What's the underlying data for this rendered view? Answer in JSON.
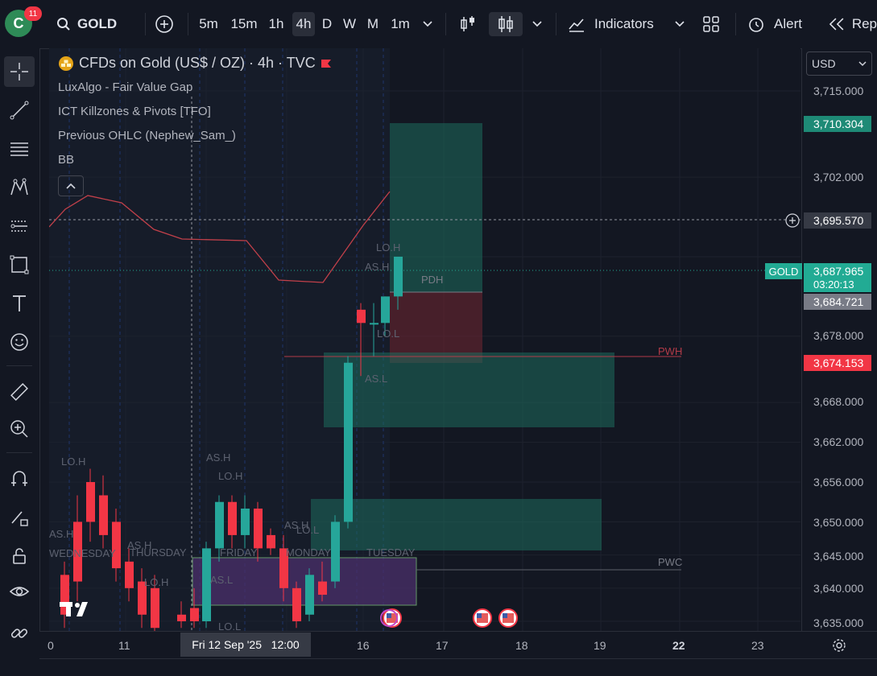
{
  "topbar": {
    "avatar_letter": "C",
    "notif_count": "11",
    "symbol": "GOLD",
    "intervals": [
      "5m",
      "15m",
      "1h",
      "4h",
      "D",
      "W",
      "M",
      "1m"
    ],
    "active_interval": "4h",
    "indicators_label": "Indicators",
    "alert_label": "Alert",
    "replay_label": "Rep"
  },
  "legend": {
    "title": "CFDs on Gold (US$ / OZ) · 4h · TVC",
    "indicators": [
      "LuxAlgo - Fair Value Gap",
      "ICT Killzones & Pivots [TFO]",
      "Previous OHLC (Nephew_Sam_)",
      "BB"
    ]
  },
  "currency": "USD",
  "price_axis": {
    "ticks": [
      "3,715.000",
      "3,702.000",
      "3,678.000",
      "3,668.000",
      "3,662.000",
      "3,656.000",
      "3,650.000",
      "3,645.000",
      "3,640.000",
      "3,635.000"
    ],
    "labels": {
      "target": "3,710.304",
      "crosshair": "3,695.570",
      "symbol_tag": "GOLD",
      "last": "3,687.965",
      "countdown": "03:20:13",
      "prev": "3,684.721",
      "pwh": "3,674.153"
    }
  },
  "time_axis": {
    "ticks": [
      "0",
      "11",
      "16",
      "17",
      "18",
      "19",
      "22",
      "23"
    ],
    "crosshair": "Fri 12 Sep '25   12:00"
  },
  "chart_labels": {
    "lo_h": "LO.H",
    "as_h": "AS.H",
    "lo_l": "LO.L",
    "as_l": "AS.L",
    "pdh": "PDH",
    "pwh": "PWH",
    "pwc": "PWC",
    "wednesday": "WEDNESDAY",
    "thursday": "THURSDAY",
    "friday": "FRIDAY",
    "monday": "MONDAY",
    "tuesday": "TUESDAY"
  },
  "colors": {
    "up": "#26a69a",
    "down": "#f23645",
    "bb": "#c2404a",
    "background": "#131722"
  }
}
